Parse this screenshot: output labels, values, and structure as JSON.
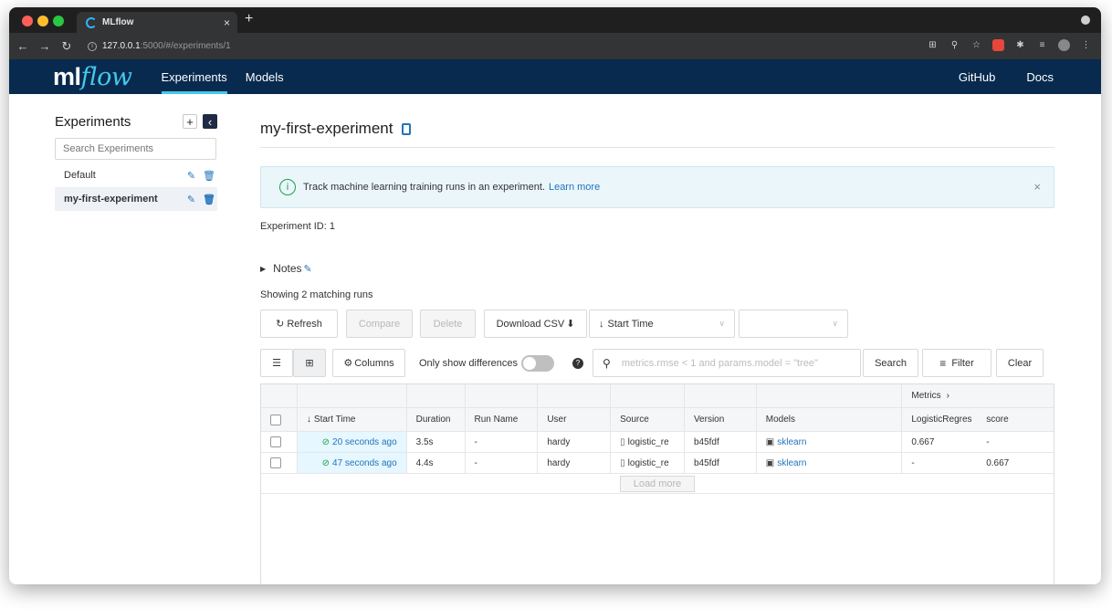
{
  "browser": {
    "tab_title": "MLflow",
    "tab_close": "×",
    "new_tab": "+",
    "url_host": "127.0.0.1",
    "url_rest": ":5000/#/experiments/1",
    "url_info": "i"
  },
  "header": {
    "logo_ml": "ml",
    "logo_flow": "flow",
    "nav_experiments": "Experiments",
    "nav_models": "Models",
    "github": "GitHub",
    "docs": "Docs"
  },
  "sidebar": {
    "title": "Experiments",
    "add_symbol": "+",
    "collapse_symbol": "‹",
    "search_placeholder": "Search Experiments",
    "items": [
      {
        "label": "Default"
      },
      {
        "label": "my-first-experiment"
      }
    ]
  },
  "main": {
    "experiment_title": "my-first-experiment",
    "banner_text": "Track machine learning training runs in an experiment.",
    "banner_link": "Learn more",
    "banner_close": "×",
    "experiment_id_label": "Experiment ID:",
    "experiment_id_value": "1",
    "notes_label": "Notes",
    "showing": "Showing 2 matching runs",
    "toolbar": {
      "refresh": "Refresh",
      "compare": "Compare",
      "delete": "Delete",
      "download": "Download CSV",
      "sort_select": "Start Time",
      "columns": "Columns",
      "only_diff": "Only show differences",
      "search_placeholder": "metrics.rmse < 1 and params.model = \"tree\"",
      "search": "Search",
      "filter": "Filter",
      "clear": "Clear"
    },
    "table": {
      "metrics_group": "Metrics",
      "metrics_arrow": "›",
      "headers": {
        "start_time": "Start Time",
        "duration": "Duration",
        "run_name": "Run Name",
        "user": "User",
        "source": "Source",
        "version": "Version",
        "models": "Models",
        "metric1": "LogisticRegres",
        "metric2": "score"
      },
      "rows": [
        {
          "start_time": "20 seconds ago",
          "duration": "3.5s",
          "run_name": "-",
          "user": "hardy",
          "source": "logistic_re",
          "version": "b45fdf",
          "models": "sklearn",
          "metric1": "0.667",
          "metric2": "-"
        },
        {
          "start_time": "47 seconds ago",
          "duration": "4.4s",
          "run_name": "-",
          "user": "hardy",
          "source": "logistic_re",
          "version": "b45fdf",
          "models": "sklearn",
          "metric1": "-",
          "metric2": "0.667"
        }
      ],
      "load_more": "Load more"
    }
  },
  "colors": {
    "header_bg": "#082a4e",
    "accent": "#43c9ed",
    "link": "#2374bb",
    "success": "#1aa24a"
  }
}
